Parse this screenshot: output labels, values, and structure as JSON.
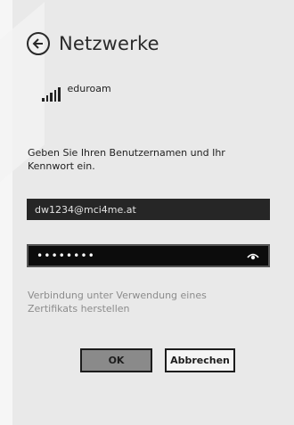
{
  "header": {
    "back_icon": "back-arrow-circle-icon",
    "title": "Netzwerke"
  },
  "network": {
    "signal_icon": "signal-strength-icon",
    "name": "eduroam"
  },
  "form": {
    "instructions": "Geben Sie Ihren Benutzernamen und Ihr Kennwort ein.",
    "username_value": "dw1234@mci4me.at",
    "password_value": "••••••••",
    "reveal_icon": "eye-reveal-icon",
    "certificate_link": "Verbindung unter Verwendung eines Zertifikats herstellen"
  },
  "buttons": {
    "ok_label": "OK",
    "cancel_label": "Abbrechen"
  },
  "colors": {
    "panel_background": "#e9e9e9",
    "field_background": "#151515",
    "link_gray": "#8c8c8c"
  }
}
